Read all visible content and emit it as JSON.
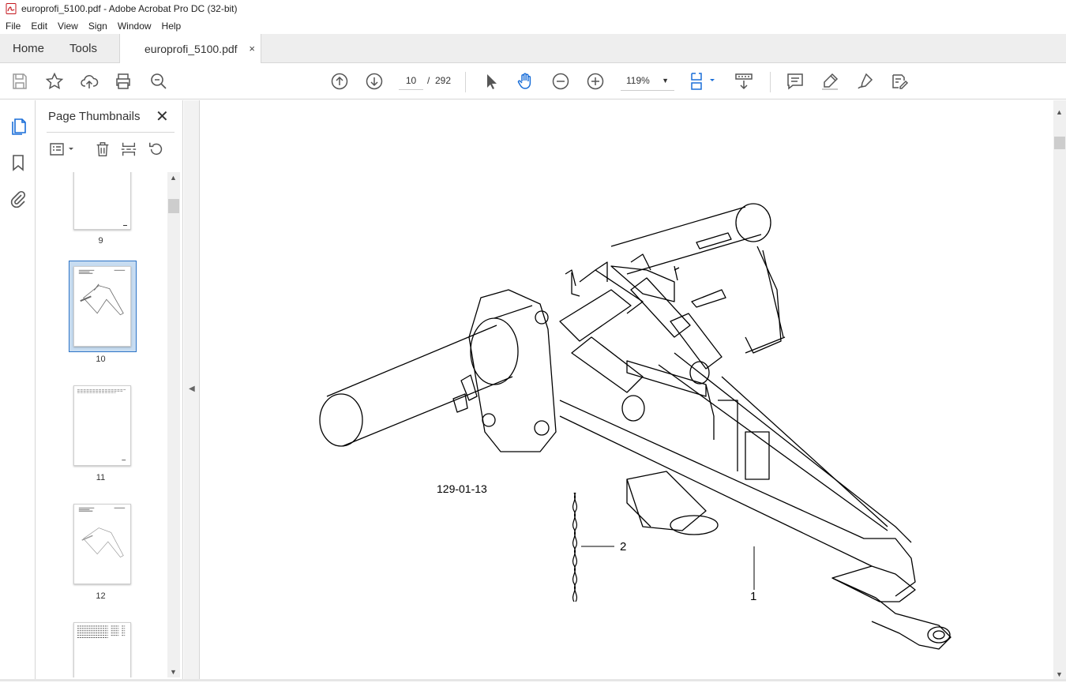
{
  "window": {
    "title": "europrofi_5100.pdf - Adobe Acrobat Pro DC (32-bit)"
  },
  "menu": {
    "items": [
      "File",
      "Edit",
      "View",
      "Sign",
      "Window",
      "Help"
    ]
  },
  "tabs": {
    "home": "Home",
    "tools": "Tools",
    "document": "europrofi_5100.pdf",
    "close_glyph": "×"
  },
  "toolbar": {
    "page_current": "10",
    "page_separator": "/",
    "page_total": "292",
    "zoom": "119%"
  },
  "panel": {
    "title": "Page Thumbnails",
    "thumbnails": [
      {
        "label": "9"
      },
      {
        "label": "10",
        "selected": true
      },
      {
        "label": "11"
      },
      {
        "label": "12"
      },
      {
        "label": ""
      }
    ]
  },
  "document": {
    "figure_code": "129-01-13",
    "callouts": [
      "1",
      "2"
    ]
  },
  "colors": {
    "accent": "#2d74c7",
    "tab_bg": "#eeeeee",
    "selection": "#c7dcf1"
  }
}
